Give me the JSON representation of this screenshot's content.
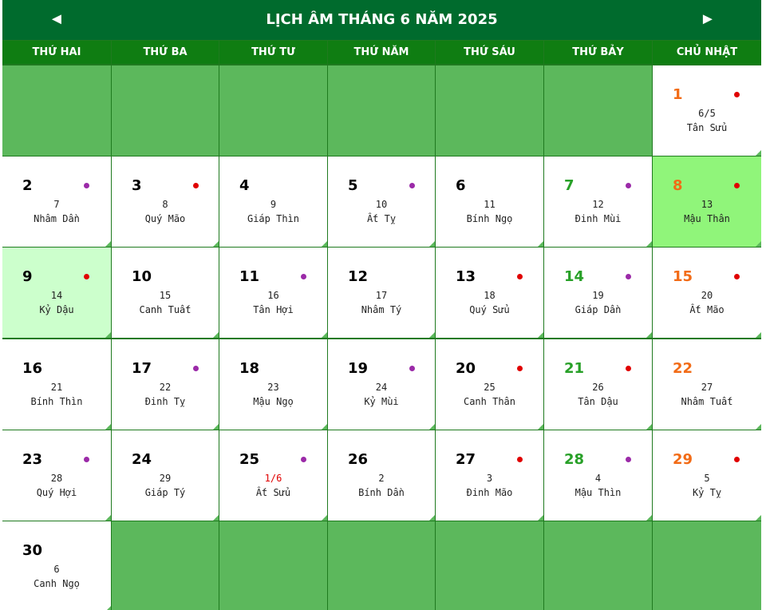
{
  "header": {
    "title": "LỊCH ÂM THÁNG 6 NĂM 2025",
    "prev_icon": "◄",
    "next_icon": "►"
  },
  "weekdays": [
    "THỨ HAI",
    "THỨ BA",
    "THỨ TƯ",
    "THỨ NĂM",
    "THỨ SÁU",
    "THỨ BẢY",
    "CHỦ NHẬT"
  ],
  "colors": {
    "header_bg": "#006b2d",
    "weekday_bg": "#0f7d12",
    "empty_cell": "#5cb85c",
    "good_day_dot": "#e00000",
    "bad_day_dot": "#9b2aa8",
    "today": "#90f57a",
    "selected": "#ccffcc",
    "saturday_number": "#28a028",
    "sunday_number": "#f26b16",
    "lunar_month_start": "#e00000"
  },
  "weeks": [
    [
      null,
      null,
      null,
      null,
      null,
      null,
      {
        "day": "1",
        "lunar": "6/5",
        "canchi": "Tân Sửu",
        "dot": "red",
        "kind": "sun"
      }
    ],
    [
      {
        "day": "2",
        "lunar": "7",
        "canchi": "Nhâm Dần",
        "dot": "purple"
      },
      {
        "day": "3",
        "lunar": "8",
        "canchi": "Quý Mão",
        "dot": "red"
      },
      {
        "day": "4",
        "lunar": "9",
        "canchi": "Giáp Thìn"
      },
      {
        "day": "5",
        "lunar": "10",
        "canchi": "Ất Tỵ",
        "dot": "purple"
      },
      {
        "day": "6",
        "lunar": "11",
        "canchi": "Bính Ngọ"
      },
      {
        "day": "7",
        "lunar": "12",
        "canchi": "Đinh Mùi",
        "dot": "purple",
        "kind": "sat"
      },
      {
        "day": "8",
        "lunar": "13",
        "canchi": "Mậu Thân",
        "dot": "red",
        "kind": "sun",
        "hl": "strong"
      }
    ],
    [
      {
        "day": "9",
        "lunar": "14",
        "canchi": "Kỷ Dậu",
        "dot": "red",
        "hl": "light"
      },
      {
        "day": "10",
        "lunar": "15",
        "canchi": "Canh Tuất"
      },
      {
        "day": "11",
        "lunar": "16",
        "canchi": "Tân Hợi",
        "dot": "purple"
      },
      {
        "day": "12",
        "lunar": "17",
        "canchi": "Nhâm Tý"
      },
      {
        "day": "13",
        "lunar": "18",
        "canchi": "Quý Sửu",
        "dot": "red"
      },
      {
        "day": "14",
        "lunar": "19",
        "canchi": "Giáp Dần",
        "dot": "purple",
        "kind": "sat"
      },
      {
        "day": "15",
        "lunar": "20",
        "canchi": "Ất Mão",
        "dot": "red",
        "kind": "sun"
      }
    ],
    [
      {
        "day": "16",
        "lunar": "21",
        "canchi": "Bính Thìn"
      },
      {
        "day": "17",
        "lunar": "22",
        "canchi": "Đinh Tỵ",
        "dot": "purple"
      },
      {
        "day": "18",
        "lunar": "23",
        "canchi": "Mậu Ngọ"
      },
      {
        "day": "19",
        "lunar": "24",
        "canchi": "Kỷ Mùi",
        "dot": "purple"
      },
      {
        "day": "20",
        "lunar": "25",
        "canchi": "Canh Thân",
        "dot": "red"
      },
      {
        "day": "21",
        "lunar": "26",
        "canchi": "Tân Dậu",
        "dot": "red",
        "kind": "sat"
      },
      {
        "day": "22",
        "lunar": "27",
        "canchi": "Nhâm Tuất",
        "kind": "sun"
      }
    ],
    [
      {
        "day": "23",
        "lunar": "28",
        "canchi": "Quý Hợi",
        "dot": "purple"
      },
      {
        "day": "24",
        "lunar": "29",
        "canchi": "Giáp Tý"
      },
      {
        "day": "25",
        "lunar": "1/6",
        "canchi": "Ất Sửu",
        "dot": "purple",
        "lunar_red": true
      },
      {
        "day": "26",
        "lunar": "2",
        "canchi": "Bính Dần"
      },
      {
        "day": "27",
        "lunar": "3",
        "canchi": "Đinh Mão",
        "dot": "red"
      },
      {
        "day": "28",
        "lunar": "4",
        "canchi": "Mậu Thìn",
        "dot": "purple",
        "kind": "sat"
      },
      {
        "day": "29",
        "lunar": "5",
        "canchi": "Kỷ Tỵ",
        "dot": "red",
        "kind": "sun"
      }
    ],
    [
      {
        "day": "30",
        "lunar": "6",
        "canchi": "Canh Ngọ"
      },
      null,
      null,
      null,
      null,
      null,
      null
    ]
  ]
}
